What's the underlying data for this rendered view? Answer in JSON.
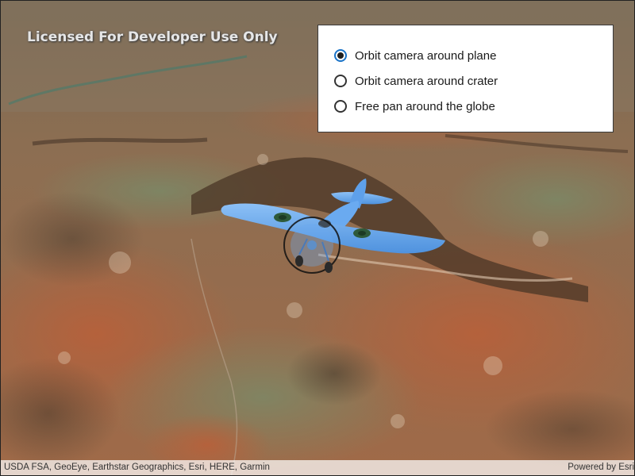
{
  "watermark": {
    "text": "Licensed For Developer Use Only"
  },
  "options": {
    "items": [
      {
        "label": "Orbit camera around plane",
        "checked": true
      },
      {
        "label": "Orbit camera around crater",
        "checked": false
      },
      {
        "label": "Free pan around the globe",
        "checked": false
      }
    ]
  },
  "attribution": {
    "text": "USDA FSA, GeoEye, Earthstar Geographics, Esri, HERE, Garmin",
    "powered_by": "Powered by Esri"
  },
  "scene": {
    "description_icon": "airplane-icon",
    "colors": {
      "terrain_base": "#9a6a48",
      "terrain_red": "#b0603a",
      "terrain_dark": "#4a3a2a",
      "plane": "#6aaaf0",
      "radio_accent": "#1a73c8"
    }
  }
}
